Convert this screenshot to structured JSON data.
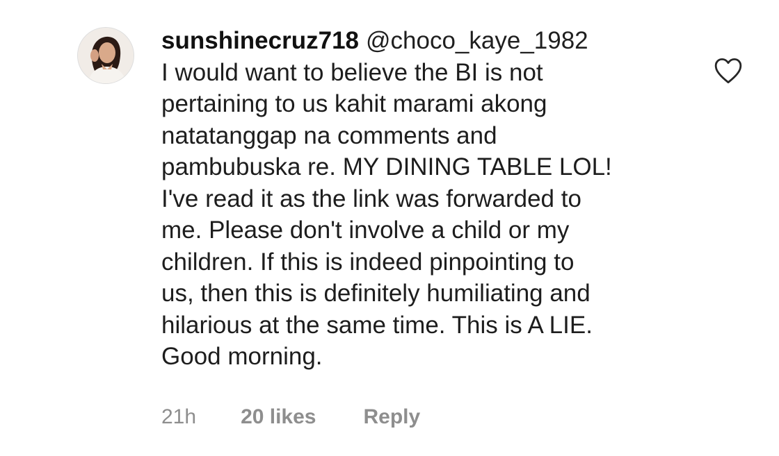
{
  "comment": {
    "username": "sunshinecruz718",
    "mention": "@choco_kaye_1982",
    "lines": [
      "I would want to believe the BI is not",
      "pertaining to us kahit marami akong",
      "natatanggap na comments and",
      "pambubuska re. MY DINING TABLE LOL!",
      "I've read it as the link was forwarded to",
      "me. Please don't involve a child or my",
      "children. If this is indeed pinpointing to",
      "us, then this is definitely humiliating and",
      "hilarious at the same time. This is A LIE.",
      "Good morning."
    ],
    "time": "21h",
    "likes": "20 likes",
    "reply": "Reply"
  },
  "icons": {
    "like": "heart-outline-icon",
    "avatar": "profile-avatar"
  },
  "colors": {
    "text": "#1d1d1d",
    "meta": "#8e8e8e",
    "icon": "#262626"
  }
}
